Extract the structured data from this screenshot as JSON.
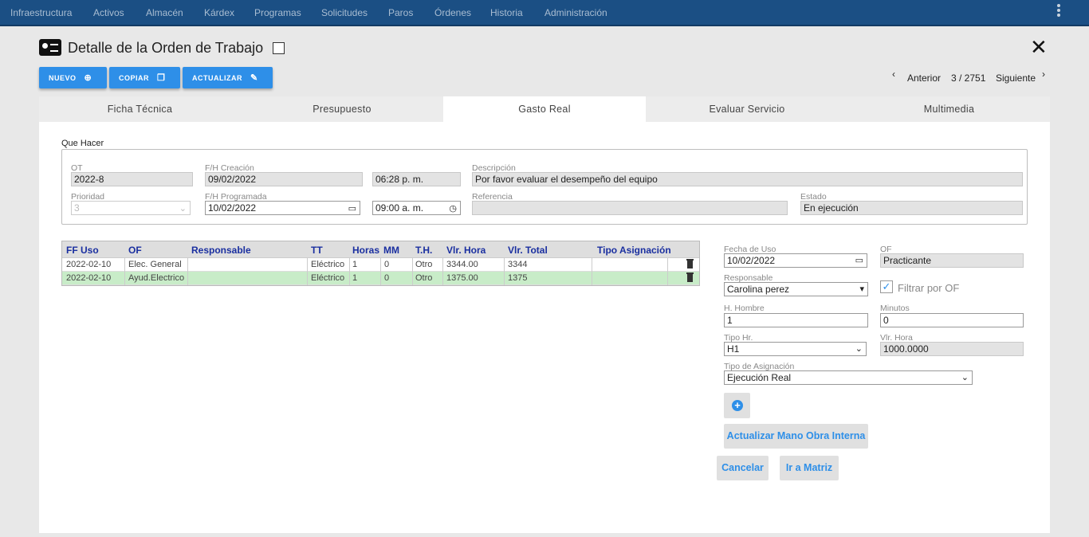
{
  "topnav": {
    "items": [
      "Infraestructura",
      "Activos",
      "Almacén",
      "Kárdex",
      "Programas",
      "Solicitudes",
      "Paros",
      "Órdenes",
      "Historia",
      "Administración"
    ],
    "menu_icon": "more-vert-icon"
  },
  "header": {
    "title": "Detalle de la Orden de Trabajo",
    "icon": "contact-card-icon",
    "close_icon": "close-icon"
  },
  "toolbar": {
    "new_label": "NUEVO",
    "copy_label": "COPIAR",
    "update_label": "ACTUALIZAR"
  },
  "pager": {
    "prev_label": "Anterior",
    "position": "3 / 2751",
    "next_label": "Siguiente"
  },
  "tabs": [
    {
      "label": "Ficha Técnica"
    },
    {
      "label": "Presupuesto"
    },
    {
      "label": "Gasto Real"
    },
    {
      "label": "Evaluar Servicio"
    },
    {
      "label": "Multimedia"
    }
  ],
  "active_tab": "Gasto Real",
  "que_hacer": {
    "section_label": "Que Hacer",
    "ot_label": "OT",
    "ot_value": "2022-8",
    "fh_creacion_label": "F/H Creación",
    "fh_creacion_date": "09/02/2022",
    "fh_creacion_time": "06:28 p. m.",
    "descripcion_label": "Descripción",
    "descripcion_value": "Por favor evaluar el desempeño del equipo",
    "prioridad_label": "Prioridad",
    "prioridad_value": "3",
    "fh_programada_label": "F/H Programada",
    "fh_programada_date": "10/02/2022",
    "fh_programada_time": "09:00 a. m.",
    "referencia_label": "Referencia",
    "referencia_value": "",
    "estado_label": "Estado",
    "estado_value": "En ejecución"
  },
  "grid": {
    "columns": [
      "FF Uso",
      "OF",
      "Responsable",
      "TT",
      "Horas",
      "MM",
      "T.H.",
      "Vlr. Hora",
      "Vlr. Total",
      "Tipo Asignación"
    ],
    "rows": [
      {
        "ff_uso": "2022-02-10",
        "of": "Elec. General",
        "responsable": "",
        "tt": "Eléctrico",
        "horas": "1",
        "mm": "0",
        "th": "Otro",
        "vlr_hora": "3344.00",
        "vlr_total": "3344",
        "tipo": ""
      },
      {
        "ff_uso": "2022-02-10",
        "of": "Ayud.Electrico",
        "responsable": "",
        "tt": "Eléctrico",
        "horas": "1",
        "mm": "0",
        "th": "Otro",
        "vlr_hora": "1375.00",
        "vlr_total": "1375",
        "tipo": ""
      }
    ],
    "selected_row": 1
  },
  "form": {
    "fecha_uso_label": "Fecha de Uso",
    "fecha_uso_value": "10/02/2022",
    "of_label": "OF",
    "of_value": "Practicante",
    "responsable_label": "Responsable",
    "responsable_value": "Carolina perez",
    "filtrar_label": "Filtrar por OF",
    "filtrar_checked": true,
    "h_hombre_label": "H. Hombre",
    "h_hombre_value": "1",
    "minutos_label": "Minutos",
    "minutos_value": "0",
    "tipo_hr_label": "Tipo Hr.",
    "tipo_hr_value": "H1",
    "vlr_hora_label": "Vlr. Hora",
    "vlr_hora_value": "1000.0000",
    "tipo_asignacion_label": "Tipo de Asignación",
    "tipo_asignacion_value": "Ejecución Real",
    "add_icon": "add-circle-icon",
    "actualizar_label": "Actualizar Mano Obra Interna",
    "cancelar_label": "Cancelar",
    "matriz_label": "Ir a Matriz"
  },
  "colors": {
    "navbar": "#1b4f84",
    "accent": "#2e8fe8",
    "selected_row": "#c8ecc8"
  }
}
